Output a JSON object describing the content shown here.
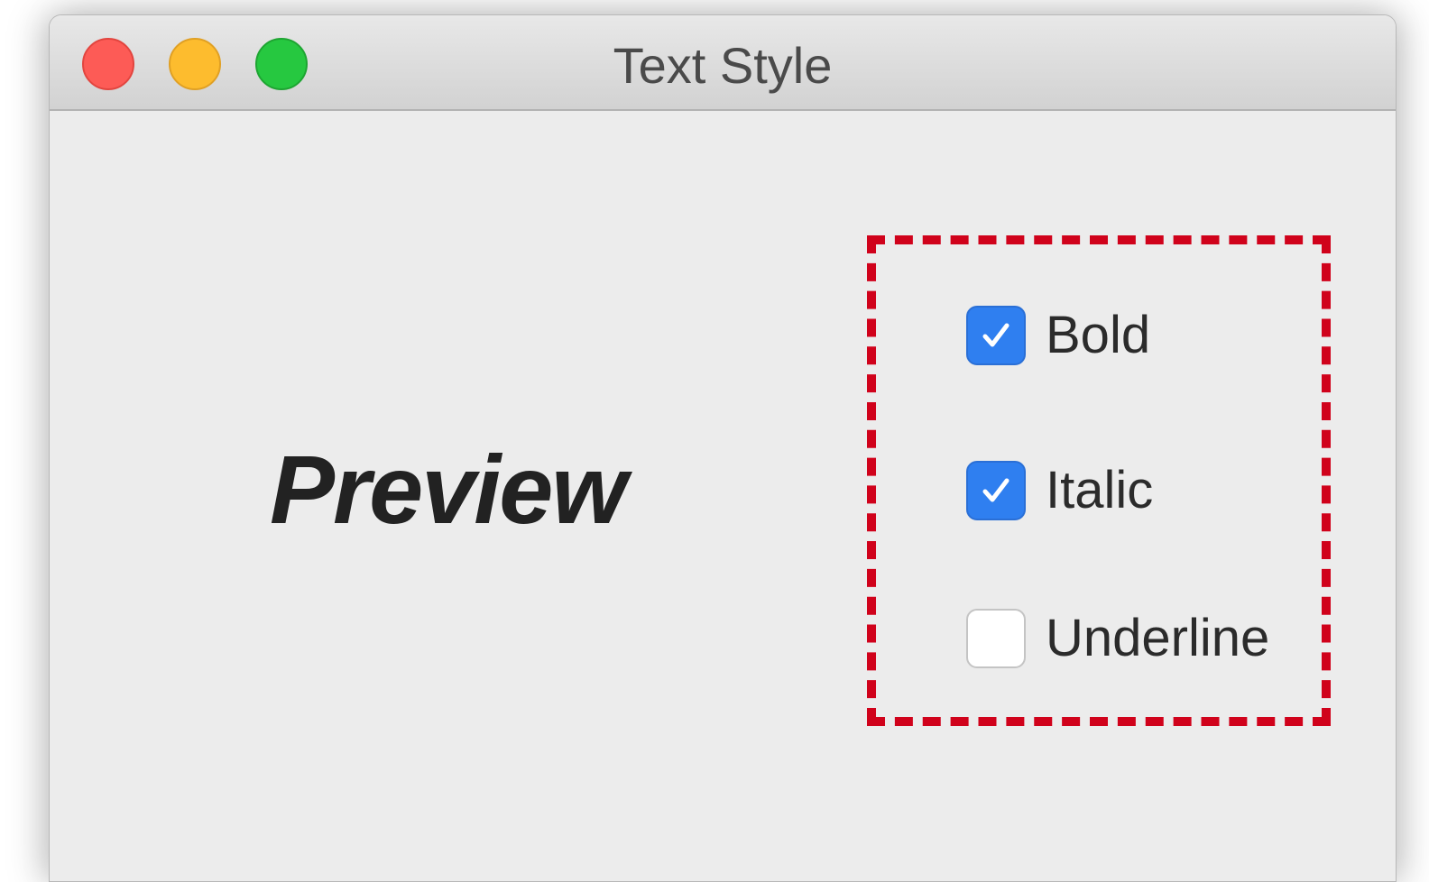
{
  "window": {
    "title": "Text Style",
    "controls": {
      "close_icon": "close-button-icon",
      "minimize_icon": "minimize-button-icon",
      "zoom_icon": "zoom-button-icon"
    }
  },
  "preview": {
    "text": "Preview"
  },
  "options": [
    {
      "label": "Bold",
      "checked": true
    },
    {
      "label": "Italic",
      "checked": true
    },
    {
      "label": "Underline",
      "checked": false
    }
  ],
  "colors": {
    "accent": "#2f7ff0",
    "highlight_dashed_border": "#d0021b",
    "close": "#fd5b56",
    "minimize": "#fdbc2e",
    "zoom": "#26c840"
  }
}
